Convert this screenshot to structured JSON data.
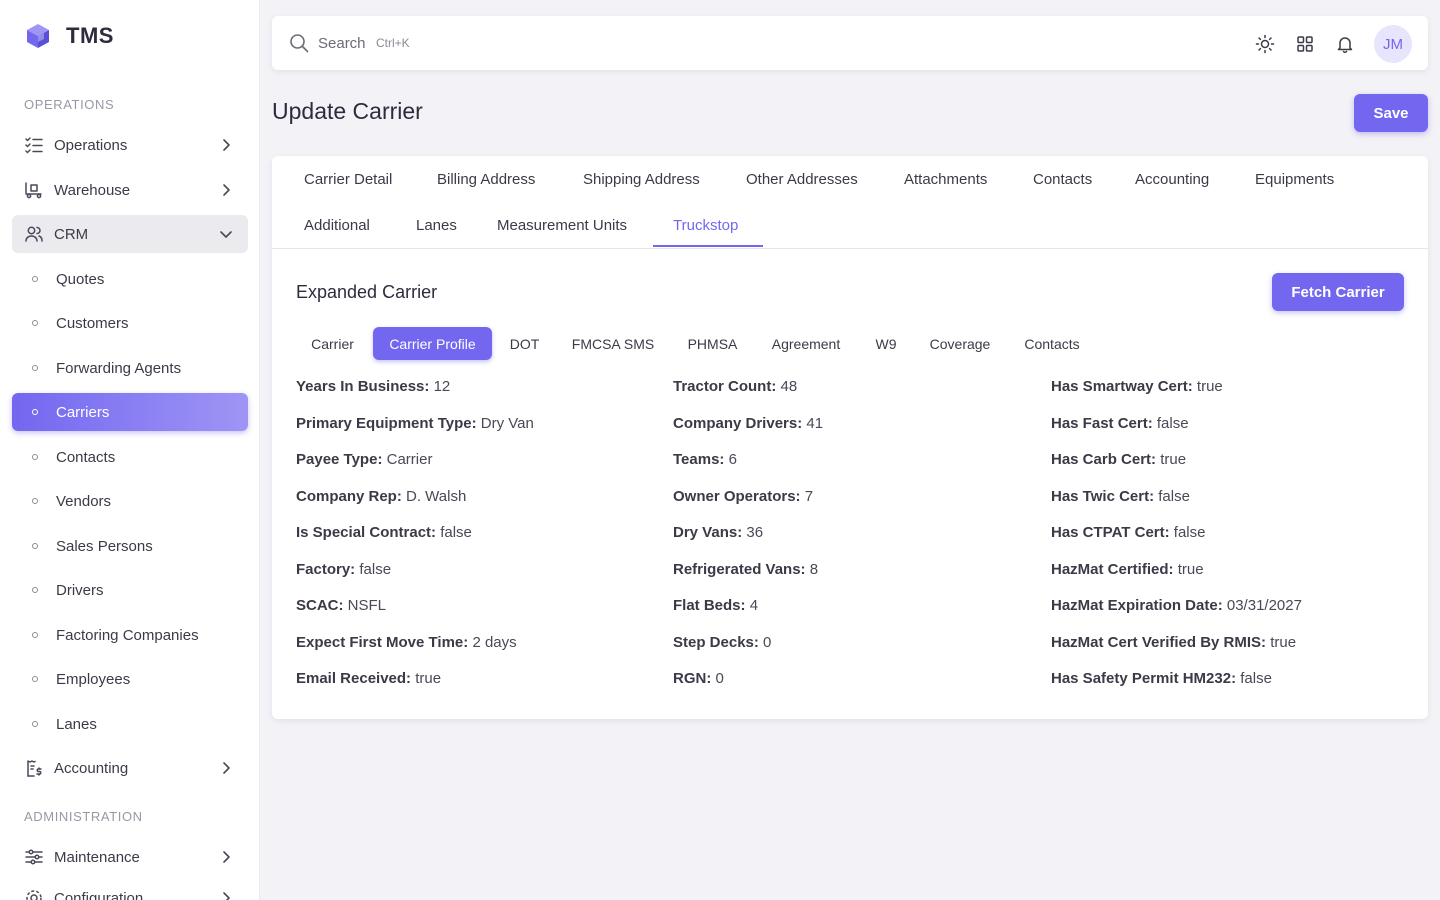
{
  "brand": {
    "name": "TMS"
  },
  "sidebar": {
    "sections": {
      "operations": "OPERATIONS",
      "administration": "ADMINISTRATION"
    },
    "top_items": [
      {
        "label": "Operations",
        "icon": "list-check-icon"
      },
      {
        "label": "Warehouse",
        "icon": "truck-loading-icon"
      },
      {
        "label": "CRM",
        "icon": "users-icon"
      }
    ],
    "crm_items": [
      "Quotes",
      "Customers",
      "Forwarding Agents",
      "Carriers",
      "Contacts",
      "Vendors",
      "Sales Persons",
      "Drivers",
      "Factoring Companies",
      "Employees",
      "Lanes"
    ],
    "accounting": {
      "label": "Accounting",
      "icon": "receipt-dollar-icon"
    },
    "admin_items": [
      {
        "label": "Maintenance",
        "icon": "adjustments-icon"
      },
      {
        "label": "Configuration",
        "icon": "settings-icon"
      }
    ],
    "active_item": "Carriers"
  },
  "search": {
    "placeholder": "Search",
    "shortcut": "Ctrl+K"
  },
  "header": {
    "avatar_initials": "JM"
  },
  "page": {
    "title": "Update Carrier",
    "save_label": "Save"
  },
  "tabs": [
    "Carrier Detail",
    "Billing Address",
    "Shipping Address",
    "Other Addresses",
    "Attachments",
    "Contacts",
    "Accounting",
    "Equipments",
    "Additional",
    "Lanes",
    "Measurement Units",
    "Truckstop"
  ],
  "active_tab": "Truckstop",
  "expanded": {
    "title": "Expanded Carrier",
    "fetch_label": "Fetch Carrier",
    "pills": [
      "Carrier",
      "Carrier Profile",
      "DOT",
      "FMCSA SMS",
      "PHMSA",
      "Agreement",
      "W9",
      "Coverage",
      "Contacts"
    ],
    "active_pill": "Carrier Profile",
    "columns": [
      [
        {
          "k": "Years In Business:",
          "v": "12"
        },
        {
          "k": "Primary Equipment Type:",
          "v": "Dry Van"
        },
        {
          "k": "Payee Type:",
          "v": "Carrier"
        },
        {
          "k": "Company Rep:",
          "v": "D. Walsh"
        },
        {
          "k": "Is Special Contract:",
          "v": "false"
        },
        {
          "k": "Factory:",
          "v": "false"
        },
        {
          "k": "SCAC:",
          "v": "NSFL"
        },
        {
          "k": "Expect First Move Time:",
          "v": "2 days"
        },
        {
          "k": "Email Received:",
          "v": "true"
        }
      ],
      [
        {
          "k": "Tractor Count:",
          "v": "48"
        },
        {
          "k": "Company Drivers:",
          "v": "41"
        },
        {
          "k": "Teams:",
          "v": "6"
        },
        {
          "k": "Owner Operators:",
          "v": "7"
        },
        {
          "k": "Dry Vans:",
          "v": "36"
        },
        {
          "k": "Refrigerated Vans:",
          "v": "8"
        },
        {
          "k": "Flat Beds:",
          "v": "4"
        },
        {
          "k": "Step Decks:",
          "v": "0"
        },
        {
          "k": "RGN:",
          "v": "0"
        }
      ],
      [
        {
          "k": "Has Smartway Cert:",
          "v": "true"
        },
        {
          "k": "Has Fast Cert:",
          "v": "false"
        },
        {
          "k": "Has Carb Cert:",
          "v": "true"
        },
        {
          "k": "Has Twic Cert:",
          "v": "false"
        },
        {
          "k": "Has CTPAT Cert:",
          "v": "false"
        },
        {
          "k": "HazMat Certified:",
          "v": "true"
        },
        {
          "k": "HazMat Expiration Date:",
          "v": "03/31/2027"
        },
        {
          "k": "HazMat Cert Verified By RMIS:",
          "v": "true"
        },
        {
          "k": "Has Safety Permit HM232:",
          "v": "false"
        }
      ]
    ]
  },
  "colors": {
    "accent": "#7367f0",
    "background": "#f3f2f6"
  }
}
